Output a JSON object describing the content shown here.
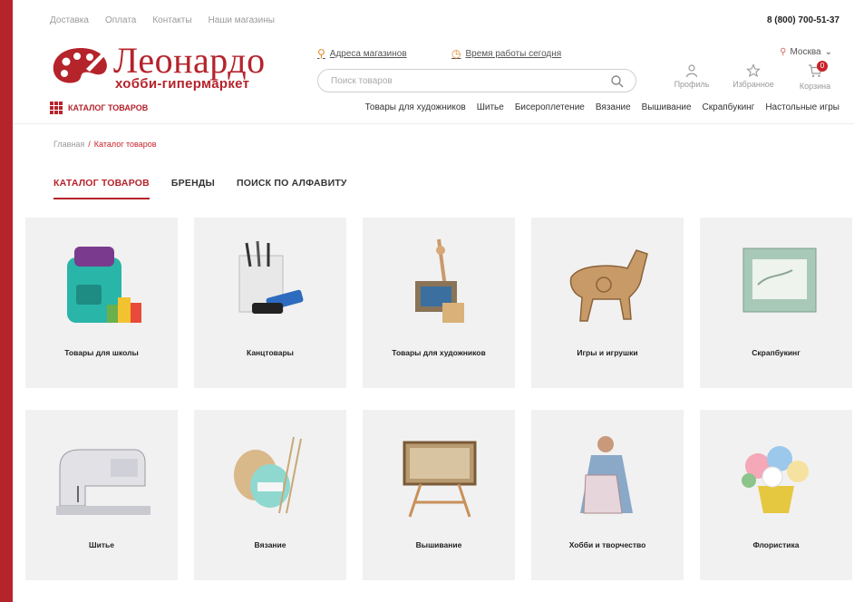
{
  "topbar": {
    "links": [
      "Доставка",
      "Оплата",
      "Контакты",
      "Наши магазины"
    ],
    "phone": "8 (800) 700-51-37"
  },
  "logo": {
    "name": "Леонардо",
    "subtitle": "хобби-гипермаркет"
  },
  "header": {
    "store_address_link": "Адреса магазинов",
    "hours_link": "Время работы сегодня",
    "city": "Москва",
    "search_placeholder": "Поиск товаров",
    "profile_label": "Профиль",
    "favorites_label": "Избранное",
    "cart_label": "Корзина",
    "cart_count": "0"
  },
  "nav": {
    "catalog_button": "КАТАЛОГ ТОВАРОВ",
    "items": [
      "Товары для художников",
      "Шитье",
      "Бисероплетение",
      "Вязание",
      "Вышивание",
      "Скрапбукинг",
      "Настольные игры"
    ]
  },
  "breadcrumb": {
    "home": "Главная",
    "separator": "/",
    "current": "Каталог товаров"
  },
  "tabs": [
    "КАТАЛОГ ТОВАРОВ",
    "БРЕНДЫ",
    "ПОИСК ПО АЛФАВИТУ"
  ],
  "categories": [
    {
      "label": "Товары для школы",
      "icon": "school-backpack-icon"
    },
    {
      "label": "Канцтовары",
      "icon": "stationery-icon"
    },
    {
      "label": "Товары для художников",
      "icon": "artist-supplies-icon"
    },
    {
      "label": "Игры и игрушки",
      "icon": "wooden-horse-icon"
    },
    {
      "label": "Скрапбукинг",
      "icon": "scrapbook-card-icon"
    },
    {
      "label": "Шитье",
      "icon": "sewing-machine-icon"
    },
    {
      "label": "Вязание",
      "icon": "yarn-icon"
    },
    {
      "label": "Вышивание",
      "icon": "embroidery-frame-icon"
    },
    {
      "label": "Хобби и творчество",
      "icon": "hobby-doll-icon"
    },
    {
      "label": "Флористика",
      "icon": "flowers-icon"
    }
  ],
  "colors": {
    "brand": "#b5232b",
    "card_bg": "#f1f1f1",
    "accent_pin": "#e08a2b"
  }
}
